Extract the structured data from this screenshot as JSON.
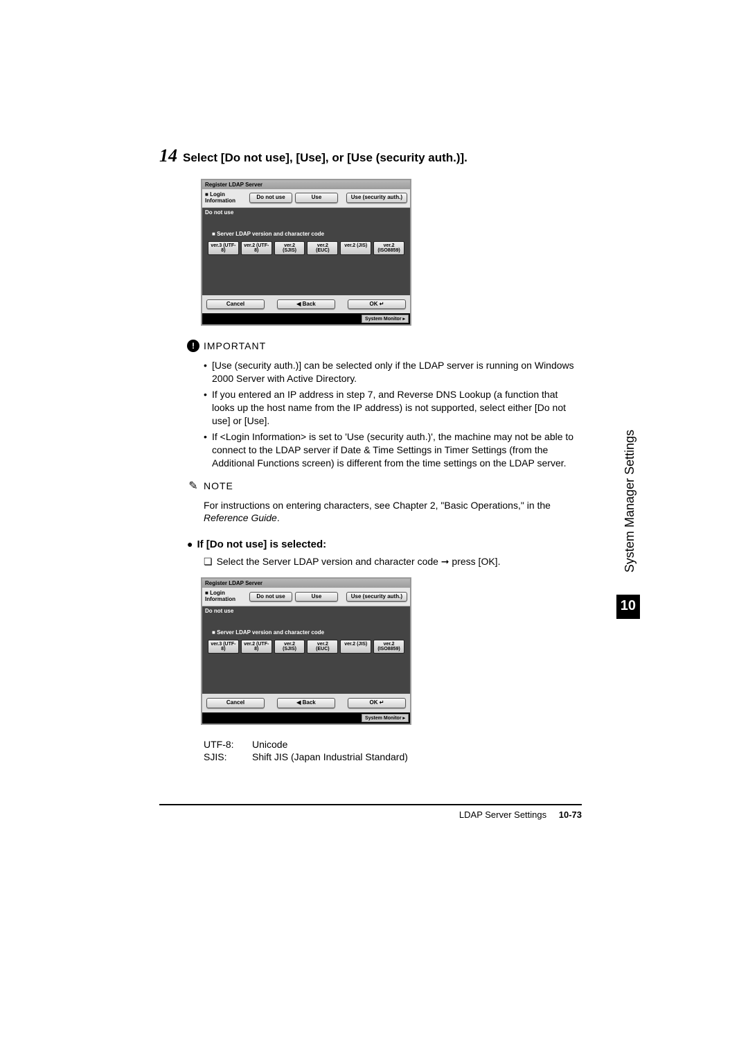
{
  "step": {
    "number": "14",
    "text": "Select [Do not use], [Use], or [Use (security auth.)]."
  },
  "screenshot1": {
    "titlebar": "Register LDAP Server",
    "login_label": "Login Information",
    "buttons": {
      "do_not_use": "Do not use",
      "use": "Use",
      "use_sec": "Use (security auth.)"
    },
    "statusbar": "Do not use",
    "body_label": "Server LDAP version and character code",
    "ver_buttons": [
      "ver.3 (UTF-8)",
      "ver.2 (UTF-8)",
      "ver.2 (SJIS)",
      "ver.2 (EUC)",
      "ver.2 (JIS)",
      "ver.2 (ISO8859)"
    ],
    "bottom": {
      "cancel": "Cancel",
      "back": "◀     Back",
      "ok": "OK   ↵"
    },
    "footer": "System Monitor ▸"
  },
  "important": {
    "label": "IMPORTANT",
    "items": [
      "[Use (security auth.)] can be selected only if the LDAP server is running on Windows 2000 Server with Active Directory.",
      "If you entered an IP address in step 7, and Reverse DNS Lookup (a function that looks up the host name from the IP address) is not supported, select either [Do not use] or [Use].",
      "If <Login Information> is set to 'Use (security auth.)', the machine may not be able to connect to the LDAP server if Date & Time Settings in Timer Settings (from the Additional Functions screen) is different from the time settings on the LDAP server."
    ]
  },
  "note": {
    "label": "NOTE",
    "text_prefix": "For instructions on entering characters, see Chapter 2, \"Basic Operations,\" in the ",
    "ref": "Reference Guide",
    "text_suffix": "."
  },
  "sub": {
    "heading": "If [Do not use] is selected:",
    "step": "Select the Server LDAP version and character code ➞ press [OK]."
  },
  "screenshot2": {
    "titlebar": "Register LDAP Server",
    "login_label": "Login Information",
    "buttons": {
      "do_not_use": "Do not use",
      "use": "Use",
      "use_sec": "Use (security auth.)"
    },
    "statusbar": "Do not use",
    "body_label": "Server LDAP version and character code",
    "ver_buttons": [
      "ver.3 (UTF-8)",
      "ver.2 (UTF-8)",
      "ver.2 (SJIS)",
      "ver.2 (EUC)",
      "ver.2 (JIS)",
      "ver.2 (ISO8859)"
    ],
    "bottom": {
      "cancel": "Cancel",
      "back": "◀     Back",
      "ok": "OK   ↵"
    },
    "footer": "System Monitor ▸"
  },
  "defs": [
    {
      "term": "UTF-8:",
      "def": "Unicode"
    },
    {
      "term": "SJIS:",
      "def": "Shift JIS (Japan Industrial Standard)"
    }
  ],
  "side_tab": "System Manager Settings",
  "side_tab_num": "10",
  "footer": {
    "section": "LDAP Server Settings",
    "page": "10-73"
  }
}
